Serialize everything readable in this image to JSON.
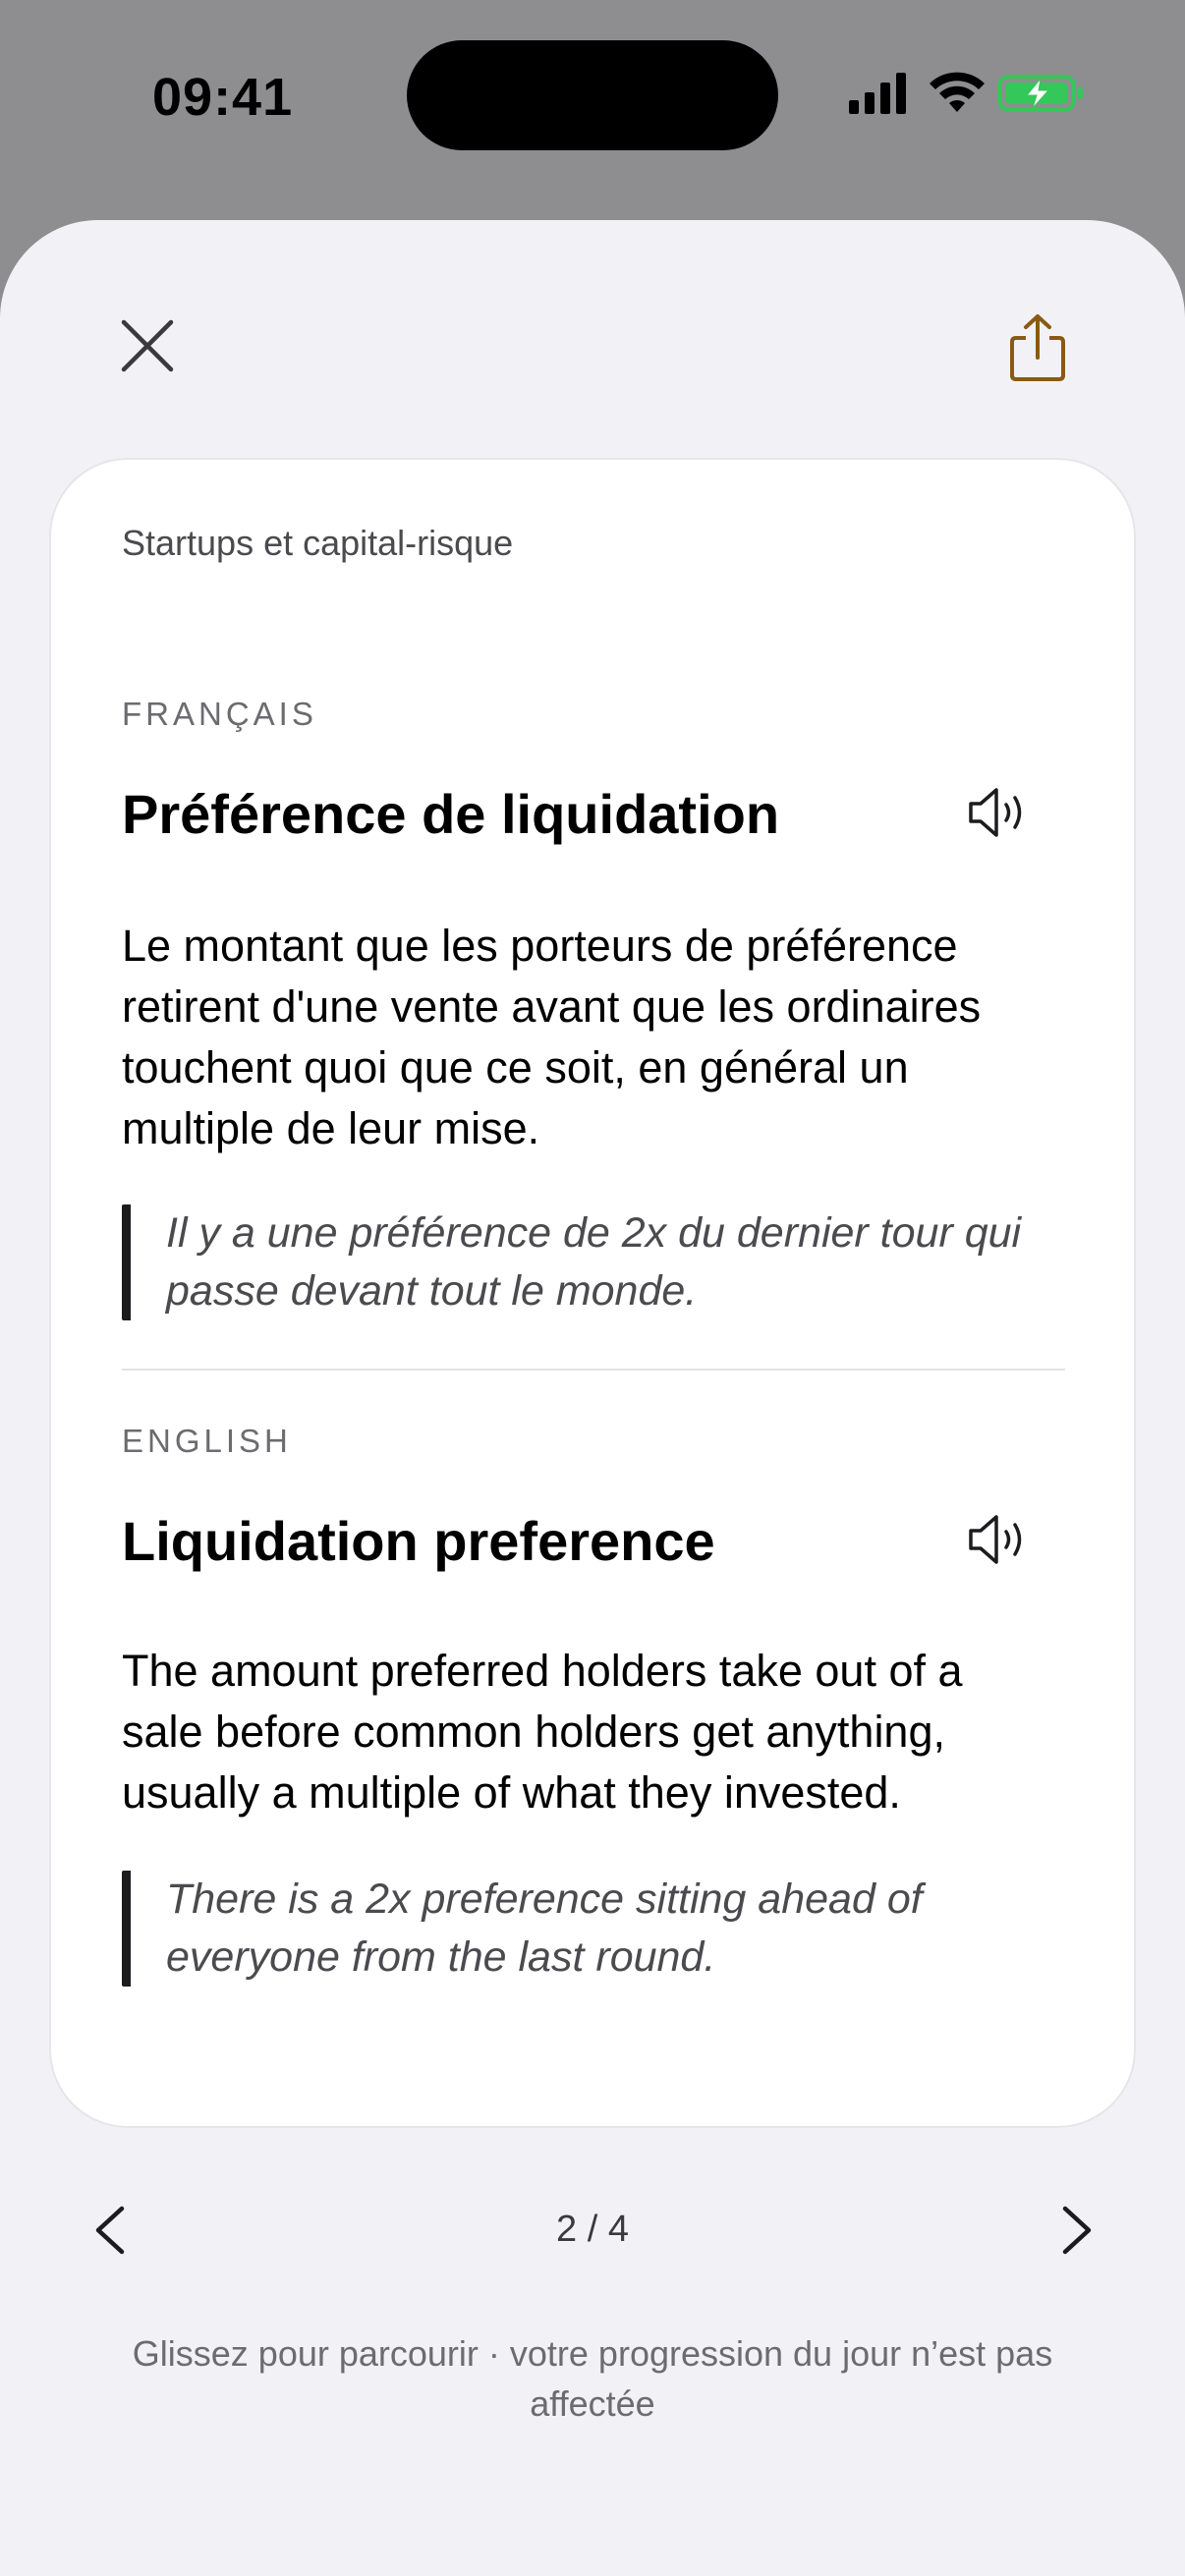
{
  "status_bar": {
    "time": "09:41"
  },
  "header": {
    "close_icon": "close-icon",
    "share_icon": "share-icon"
  },
  "card": {
    "category": "Startups et capital-risque",
    "french": {
      "label": "FRANÇAIS",
      "term": "Préférence de liquidation",
      "definition": "Le montant que les porteurs de préférence retirent d'une vente avant que les ordinaires touchent quoi que ce soit, en général un multiple de leur mise.",
      "example": "Il y a une préférence de 2x du dernier tour qui passe devant tout le monde."
    },
    "english": {
      "label": "ENGLISH",
      "term": "Liquidation preference",
      "definition": "The amount preferred holders take out of a sale before common holders get anything, usually a multiple of what they invested.",
      "example": "There is a 2x preference sitting ahead of everyone from the last round."
    }
  },
  "navigation": {
    "page_indicator": "2 / 4",
    "hint": "Glissez pour parcourir · votre progression du jour n’est pas affectée"
  },
  "colors": {
    "accent": "#8a5a14",
    "sheet_background": "#f2f2f6",
    "battery_green": "#34c759"
  }
}
